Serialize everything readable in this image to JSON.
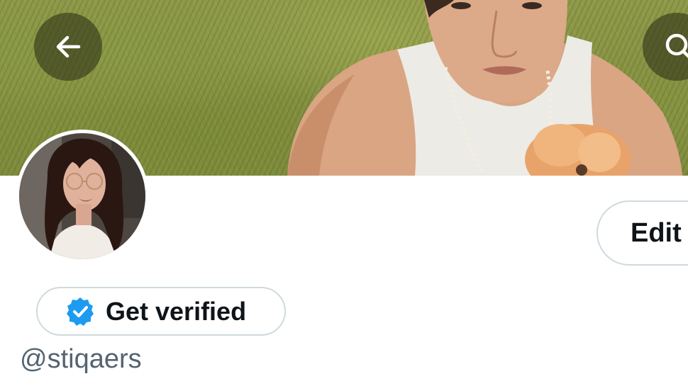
{
  "header": {
    "back_icon": "arrow-left-icon",
    "search_icon": "search-icon"
  },
  "profile": {
    "edit_label": "Edit",
    "verify_label": "Get verified",
    "verify_icon": "verified-badge-icon",
    "handle": "@stiqaers"
  },
  "colors": {
    "verified_blue": "#1d9bf0",
    "text_primary": "#0f1419",
    "text_secondary": "#536471",
    "border": "#cfd9de"
  }
}
